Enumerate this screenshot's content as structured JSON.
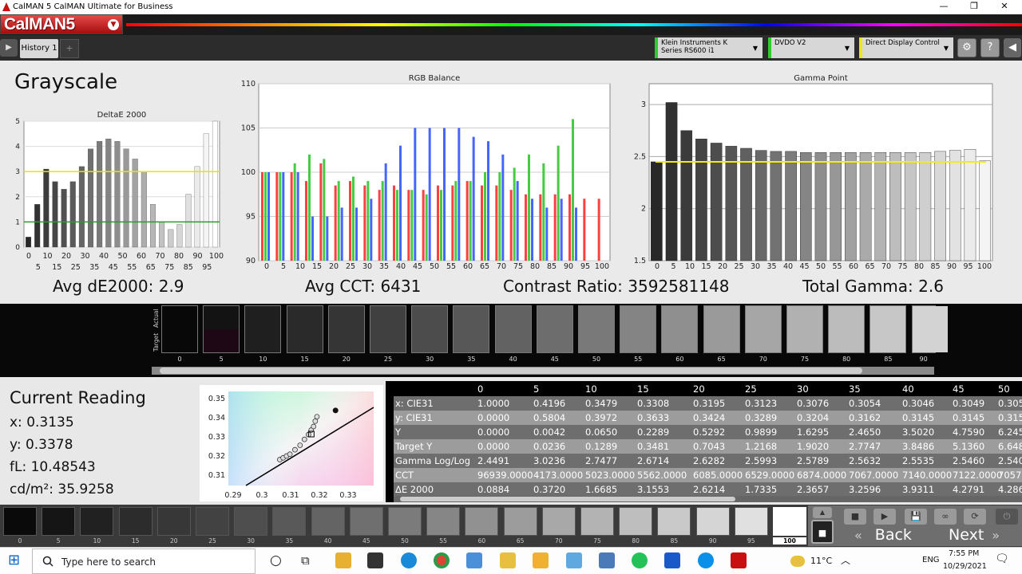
{
  "window": {
    "title": "CalMAN 5 CalMAN Ultimate for Business",
    "minimize": "—",
    "restore": "❐",
    "close": "✕"
  },
  "brand": {
    "name": "CalMAN5",
    "menu_glyph": "▼"
  },
  "tabs": {
    "nav_glyph": "▶",
    "history": "History 1",
    "add": "+"
  },
  "devices": [
    {
      "name": "Klein Instruments K Series RS600 i1",
      "color": "#2ecc2e"
    },
    {
      "name": "DVDO V2",
      "color": "#2ecc2e"
    },
    {
      "name": "Direct Display Control",
      "color": "#e8e81a"
    }
  ],
  "icons": {
    "dropdown": "▼",
    "settings": "⚙",
    "help": "?",
    "collapse": "◀"
  },
  "page": {
    "title": "Grayscale"
  },
  "metrics": {
    "avg_de": "Avg dE2000: 2.9",
    "avg_cct": "Avg CCT: 6431",
    "contrast": "Contrast Ratio: 3592581148",
    "total_gamma": "Total Gamma: 2.6"
  },
  "swatch_labels": {
    "actual": "Actual",
    "target": "Target"
  },
  "current_reading": {
    "title": "Current Reading",
    "x": "x: 0.3135",
    "y": "y: 0.3378",
    "fl": "fL: 10.48543",
    "cdm2": "cd/m²: 35.9258"
  },
  "table": {
    "columns": [
      "0",
      "5",
      "10",
      "15",
      "20",
      "25",
      "30",
      "35",
      "40",
      "45",
      "50"
    ],
    "rows": [
      {
        "label": "x: CIE31",
        "values": [
          "1.0000",
          "0.4196",
          "0.3479",
          "0.3308",
          "0.3195",
          "0.3123",
          "0.3076",
          "0.3054",
          "0.3046",
          "0.3049",
          "0.305"
        ]
      },
      {
        "label": "y: CIE31",
        "values": [
          "0.0000",
          "0.5804",
          "0.3972",
          "0.3633",
          "0.3424",
          "0.3289",
          "0.3204",
          "0.3162",
          "0.3145",
          "0.3145",
          "0.315"
        ]
      },
      {
        "label": "Y",
        "values": [
          "0.0000",
          "0.0042",
          "0.0650",
          "0.2289",
          "0.5292",
          "0.9899",
          "1.6295",
          "2.4650",
          "3.5020",
          "4.7590",
          "6.245"
        ]
      },
      {
        "label": "Target Y",
        "values": [
          "0.0000",
          "0.0236",
          "0.1289",
          "0.3481",
          "0.7043",
          "1.2168",
          "1.9020",
          "2.7747",
          "3.8486",
          "5.1360",
          "6.648"
        ]
      },
      {
        "label": "Gamma Log/Log",
        "values": [
          "2.4491",
          "3.0236",
          "2.7477",
          "2.6714",
          "2.6282",
          "2.5993",
          "2.5789",
          "2.5632",
          "2.5535",
          "2.5460",
          "2.540"
        ]
      },
      {
        "label": "CCT",
        "values": [
          "96939.0000",
          "4173.0000",
          "5023.0000",
          "5562.0000",
          "6085.0000",
          "6529.0000",
          "6874.0000",
          "7067.0000",
          "7140.0000",
          "7122.0000",
          "7057."
        ]
      },
      {
        "label": "ΔE 2000",
        "values": [
          "0.0884",
          "0.3720",
          "1.6685",
          "3.1553",
          "2.6214",
          "1.7335",
          "2.3657",
          "3.2596",
          "3.9311",
          "4.2791",
          "4.286"
        ]
      }
    ]
  },
  "strip_selected": "100",
  "controls": {
    "back": "Back",
    "next": "Next",
    "back_glyph": "«",
    "next_glyph": "»",
    "stop": "■",
    "play": "▶",
    "save": "💾",
    "loop": "∞",
    "refresh": "⟳",
    "up": "▲",
    "down": "▼",
    "power": "⏻"
  },
  "taskbar": {
    "search_placeholder": "Type here to search",
    "weather": "11°C",
    "lang": "ENG",
    "time": "7:55 PM",
    "date": "10/29/2021",
    "start_glyph": "⊞",
    "cortana_glyph": "○",
    "taskview_glyph": "⧉",
    "up_glyph": "︿",
    "notif_glyph": "🗨"
  },
  "chart_data": [
    {
      "type": "bar",
      "title": "DeltaE 2000",
      "categories": [
        "0",
        "5",
        "10",
        "15",
        "20",
        "25",
        "30",
        "35",
        "40",
        "45",
        "50",
        "55",
        "60",
        "65",
        "70",
        "75",
        "80",
        "85",
        "90",
        "95",
        "100"
      ],
      "values": [
        0.4,
        1.7,
        3.1,
        2.6,
        2.3,
        2.6,
        3.2,
        3.9,
        4.2,
        4.3,
        4.2,
        3.9,
        3.5,
        3.0,
        1.7,
        1.0,
        0.7,
        0.9,
        2.1,
        3.2,
        4.5,
        5.0
      ],
      "ylim": [
        0,
        5
      ],
      "threshold_lines": [
        {
          "value": 3,
          "color": "#e6e600"
        },
        {
          "value": 1,
          "color": "#2a9d2a"
        }
      ]
    },
    {
      "type": "bar",
      "title": "RGB Balance",
      "categories": [
        "0",
        "5",
        "10",
        "15",
        "20",
        "25",
        "30",
        "35",
        "40",
        "45",
        "50",
        "55",
        "60",
        "65",
        "70",
        "75",
        "80",
        "85",
        "90",
        "95",
        "100"
      ],
      "series": [
        {
          "color": "#ff4040",
          "values": [
            100,
            100,
            100,
            99,
            101,
            98.5,
            99,
            98.5,
            98,
            98.5,
            98,
            98,
            98.5,
            98.5,
            99,
            98.5,
            98.5,
            98,
            97.5,
            97.5,
            97.5,
            97.5,
            97,
            97
          ]
        },
        {
          "color": "#44cc44",
          "values": [
            100,
            100,
            101,
            102,
            101.5,
            99,
            99.5,
            99,
            99,
            98,
            98,
            97.5,
            98,
            99,
            99,
            100,
            100,
            100.5,
            102,
            101,
            103,
            106
          ]
        },
        {
          "color": "#4466ff",
          "values": [
            100,
            100,
            100,
            95,
            95,
            96,
            96,
            97,
            101,
            103,
            105,
            105,
            105,
            105,
            104,
            103.5,
            102,
            99,
            97,
            96,
            97,
            96
          ]
        }
      ],
      "ylim": [
        90,
        110
      ]
    },
    {
      "type": "bar",
      "title": "Gamma Point",
      "categories": [
        "0",
        "5",
        "10",
        "15",
        "20",
        "25",
        "30",
        "35",
        "40",
        "45",
        "50",
        "55",
        "60",
        "65",
        "70",
        "75",
        "80",
        "85",
        "90",
        "95",
        "100"
      ],
      "values": [
        2.45,
        3.02,
        2.75,
        2.67,
        2.63,
        2.6,
        2.58,
        2.56,
        2.55,
        2.55,
        2.54,
        2.54,
        2.54,
        2.54,
        2.54,
        2.54,
        2.54,
        2.54,
        2.54,
        2.55,
        2.56,
        2.57,
        2.46
      ],
      "target": 2.45,
      "ylim": [
        1.5,
        3.2
      ]
    },
    {
      "type": "scatter",
      "xlim": [
        0.29,
        0.33
      ],
      "ylim": [
        0.3,
        0.35
      ],
      "xticks": [
        "0.29",
        "0.3",
        "0.31",
        "0.32",
        "0.33"
      ],
      "yticks": [
        "0.35",
        "0.34",
        "0.33",
        "0.32",
        "0.31"
      ],
      "points": [
        [
          0.3035,
          0.3145
        ],
        [
          0.3045,
          0.3155
        ],
        [
          0.3055,
          0.3165
        ],
        [
          0.3065,
          0.3175
        ],
        [
          0.308,
          0.32
        ],
        [
          0.3095,
          0.3225
        ],
        [
          0.3108,
          0.3258
        ],
        [
          0.312,
          0.3285
        ],
        [
          0.3128,
          0.331
        ],
        [
          0.3135,
          0.333
        ],
        [
          0.314,
          0.336
        ],
        [
          0.3145,
          0.3385
        ]
      ],
      "target": [
        0.3127,
        0.329
      ],
      "black_point": [
        0.32,
        0.342
      ]
    }
  ]
}
